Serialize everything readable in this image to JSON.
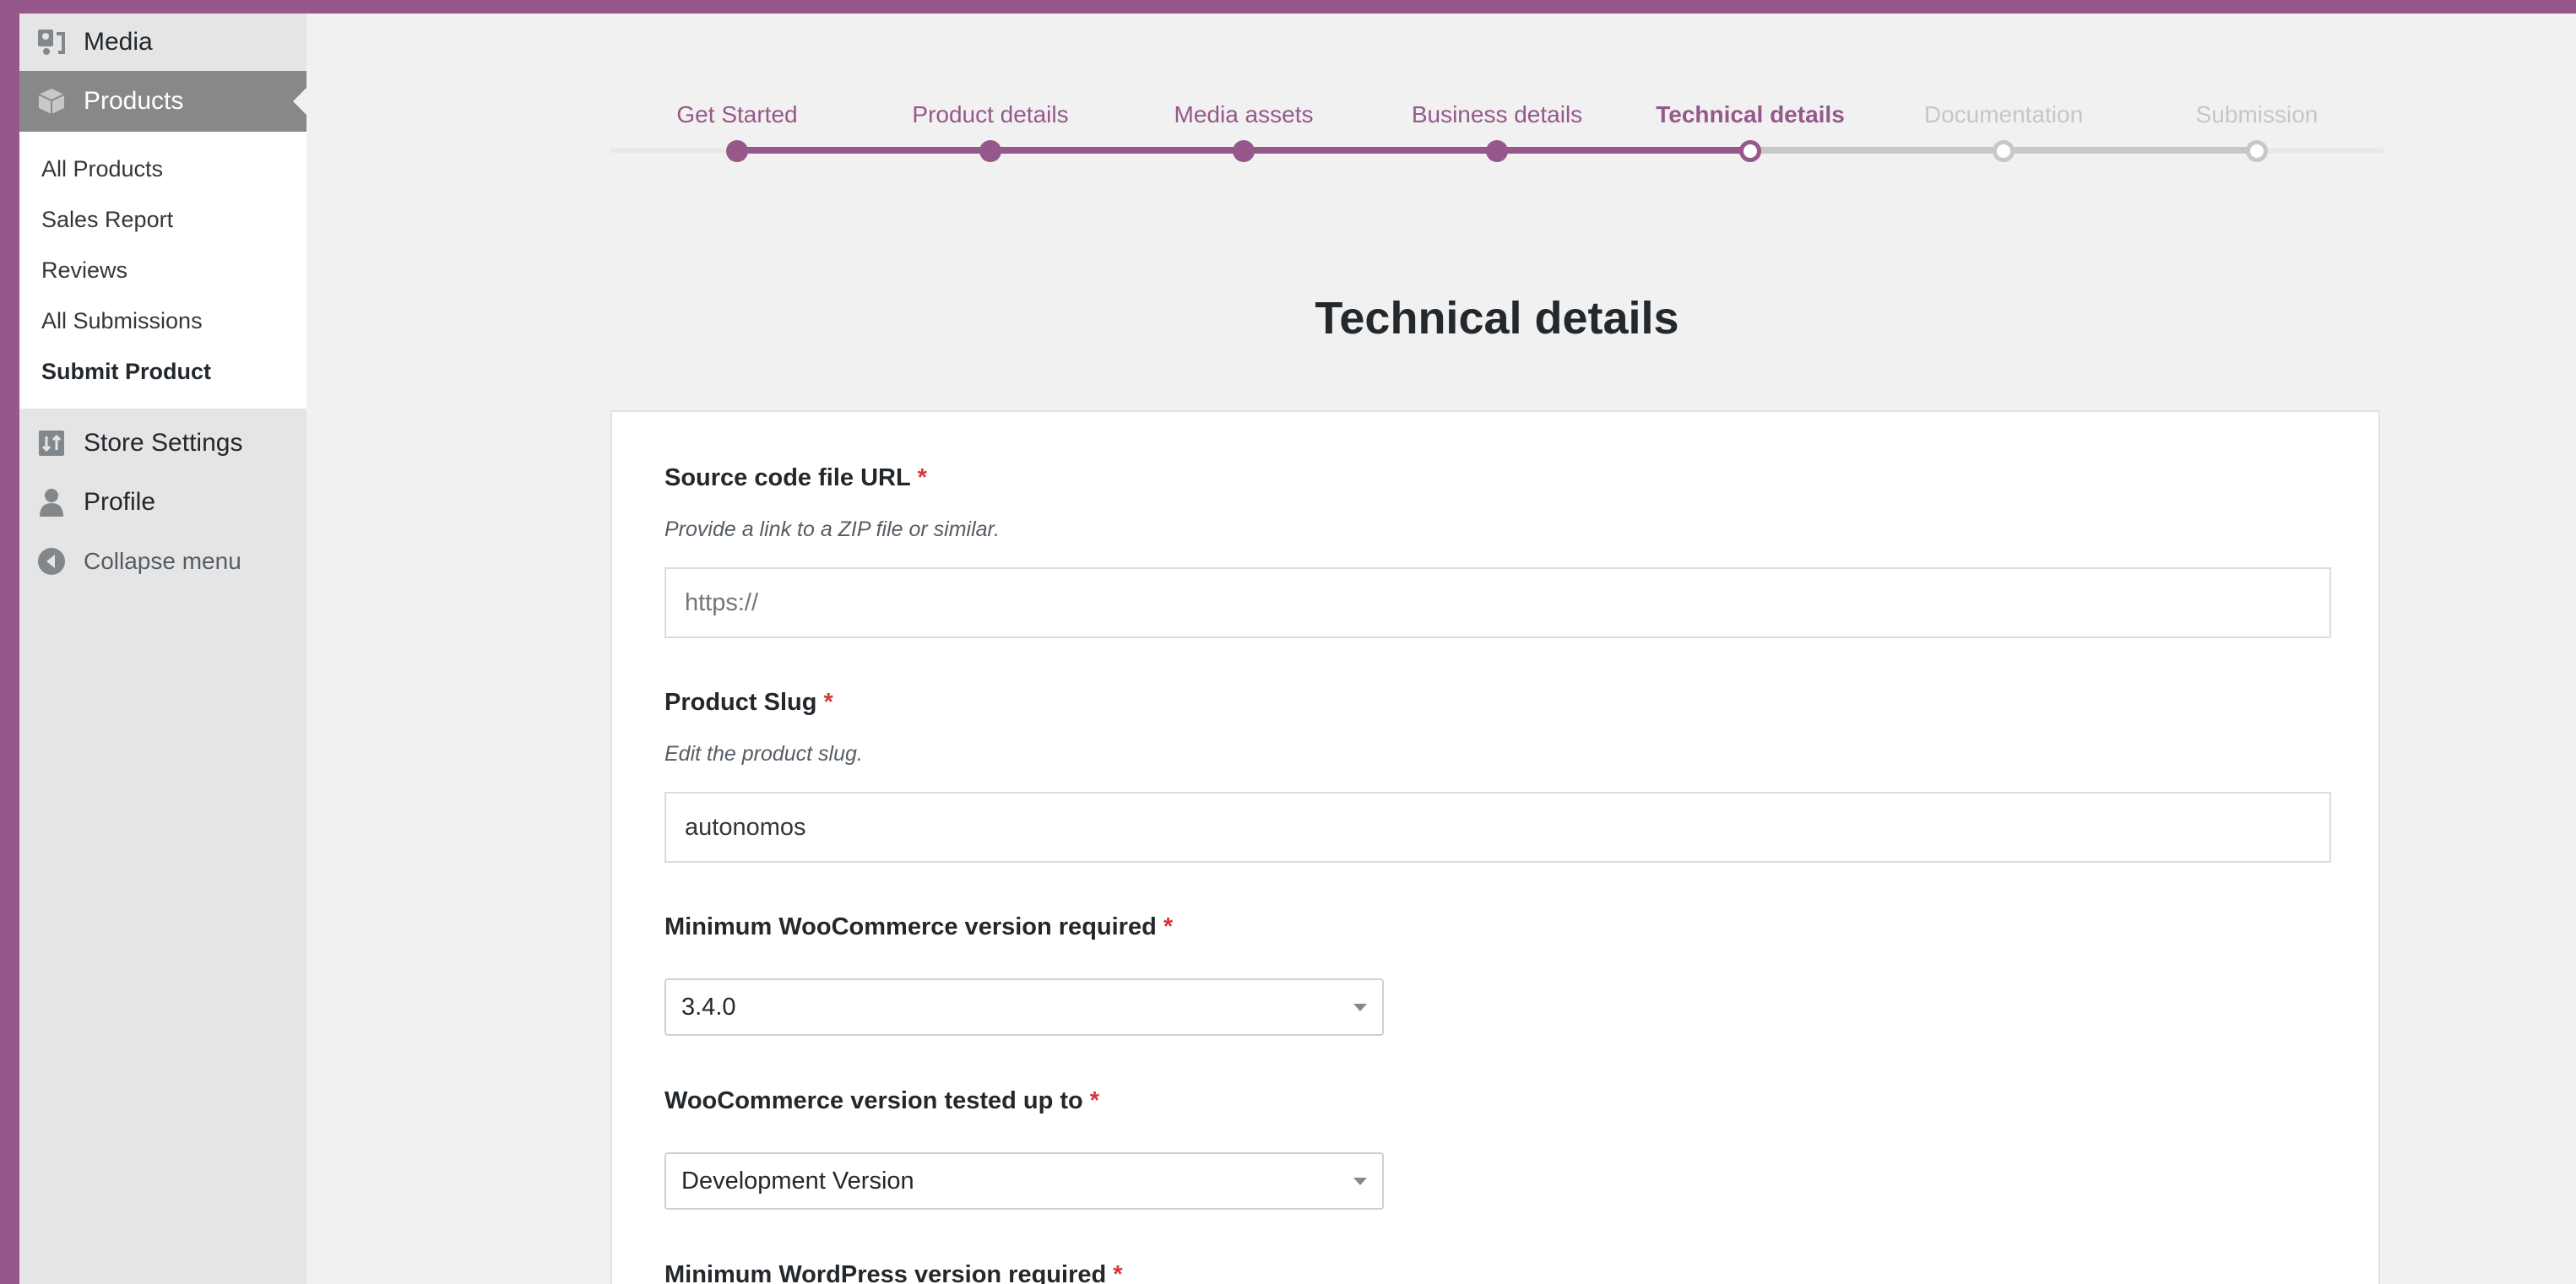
{
  "sidebar": {
    "media": "Media",
    "products": "Products",
    "submenu": [
      "All Products",
      "Sales Report",
      "Reviews",
      "All Submissions",
      "Submit Product"
    ],
    "store_settings": "Store Settings",
    "profile": "Profile",
    "collapse": "Collapse menu"
  },
  "steps": [
    "Get Started",
    "Product details",
    "Media assets",
    "Business details",
    "Technical details",
    "Documentation",
    "Submission"
  ],
  "current_step": 4,
  "page_title": "Technical details",
  "form": {
    "source_url": {
      "label": "Source code file URL",
      "required": "*",
      "help": "Provide a link to a ZIP file or similar.",
      "placeholder": "https://"
    },
    "slug": {
      "label": "Product Slug",
      "required": "*",
      "help": "Edit the product slug.",
      "value": "autonomos"
    },
    "min_wc": {
      "label": "Minimum WooCommerce version required",
      "required": "*",
      "value": "3.4.0"
    },
    "tested_wc": {
      "label": "WooCommerce version tested up to",
      "required": "*",
      "value": "Development Version"
    },
    "min_wp": {
      "label": "Minimum WordPress version required",
      "required": "*"
    }
  },
  "colors": {
    "brand": "#96588a",
    "required": "#d63638",
    "step_inactive": "#c8c8c8"
  }
}
